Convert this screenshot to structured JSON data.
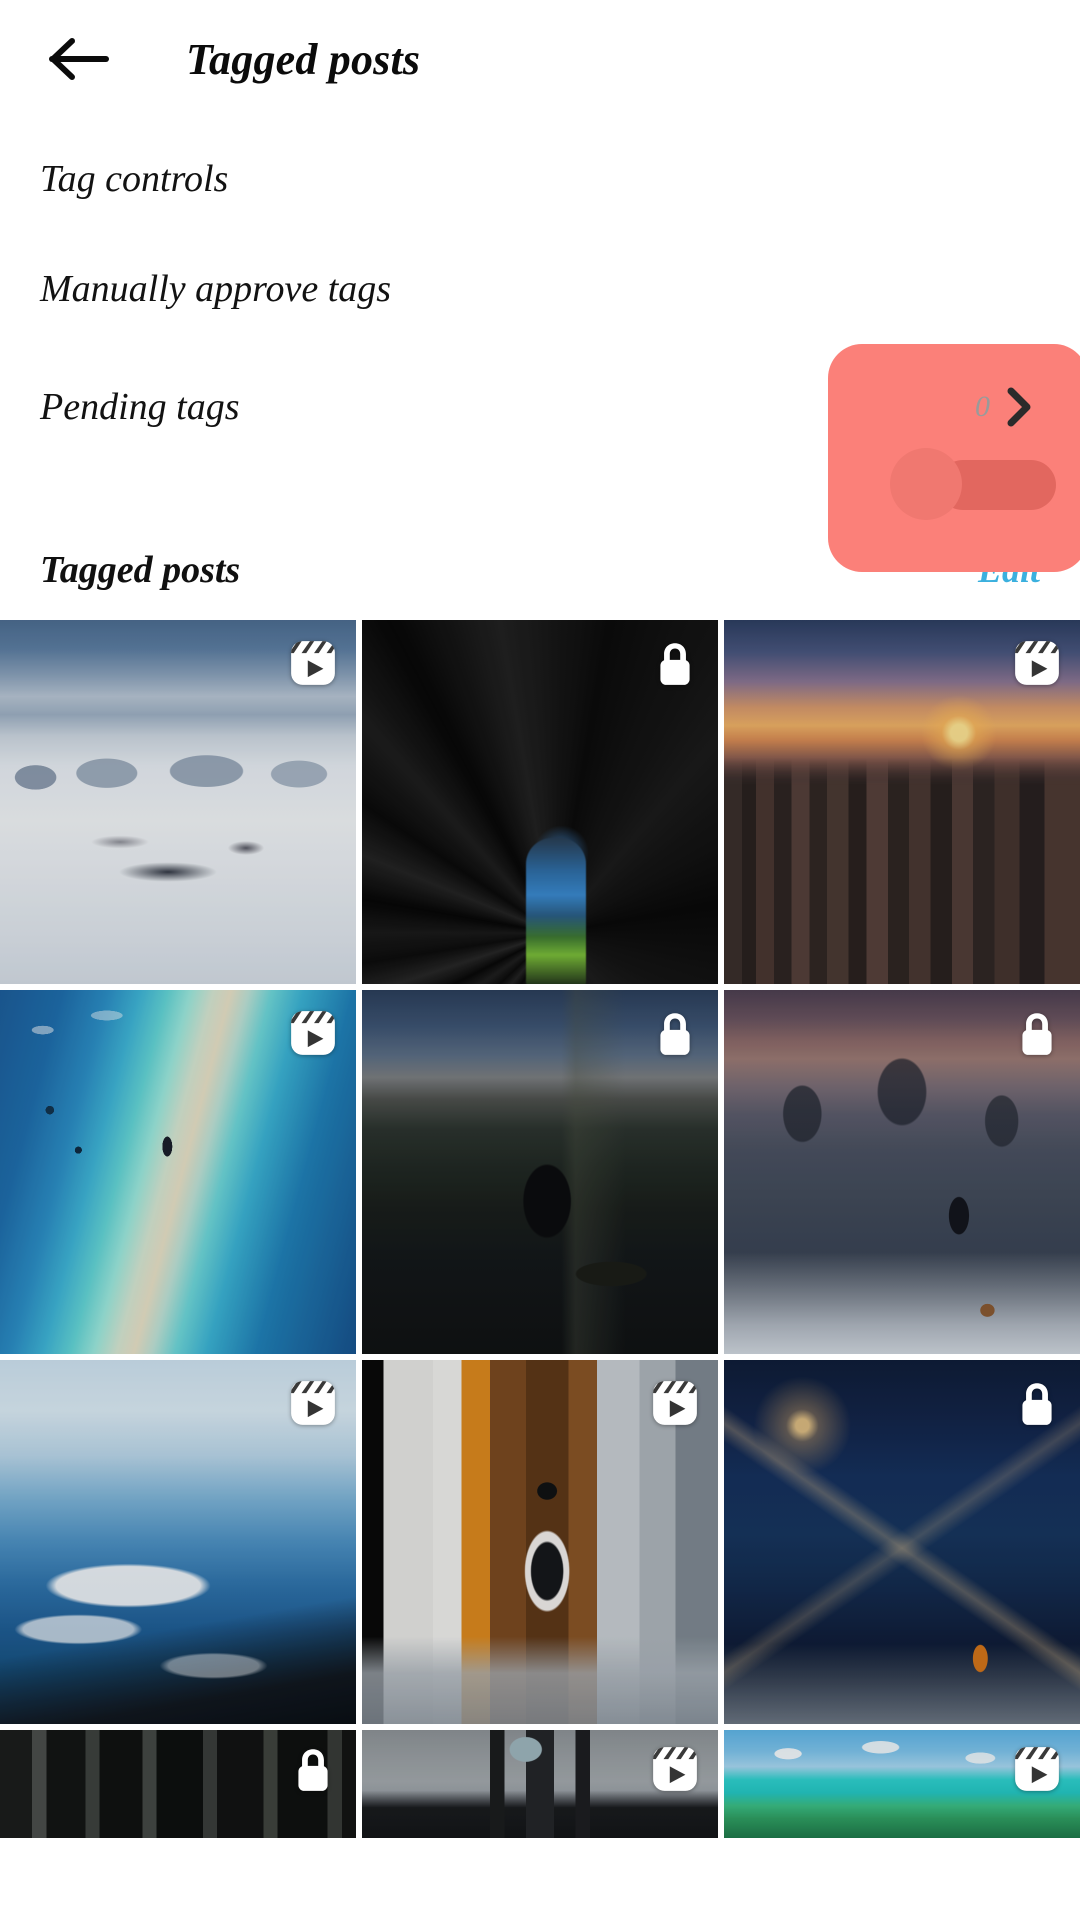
{
  "header": {
    "back_icon": "arrow-left-icon",
    "title": "Tagged posts"
  },
  "tag_controls": {
    "section_label": "Tag controls",
    "manual_approve": {
      "label": "Manually approve tags",
      "toggle_state": "off",
      "highlight_color": "#fb8079"
    },
    "pending_tags": {
      "label": "Pending tags",
      "count": "0",
      "chevron_icon": "chevron-right-icon"
    }
  },
  "tagged_posts": {
    "section_label": "Tagged posts",
    "edit_label": "Edit",
    "edit_color": "#3bb0de",
    "grid": [
      {
        "art": "ph-snowfield",
        "badge": "reels-icon",
        "alt": "snow-field-mountains"
      },
      {
        "art": "ph-forestup",
        "badge": "lock-icon",
        "alt": "looking-up-trees"
      },
      {
        "art": "ph-citysunset",
        "badge": "reels-icon",
        "alt": "city-skyline-sunset"
      },
      {
        "art": "ph-lagoon",
        "badge": "reels-icon",
        "alt": "aerial-lagoon-swimmer"
      },
      {
        "art": "ph-dusksit",
        "badge": "lock-icon",
        "alt": "person-sitting-dusk"
      },
      {
        "art": "ph-snowtrees",
        "badge": "lock-icon",
        "alt": "person-dog-snow-trees"
      },
      {
        "art": "ph-wave",
        "badge": "reels-icon",
        "alt": "boat-wake-wave"
      },
      {
        "art": "ph-dogboat",
        "badge": "reels-icon",
        "alt": "dog-on-boat-ramp"
      },
      {
        "art": "ph-starburst",
        "badge": "lock-icon",
        "alt": "person-arms-raised-night"
      },
      {
        "art": "ph-darkwoods",
        "badge": "lock-icon",
        "alt": "dark-woods"
      },
      {
        "art": "ph-ship",
        "badge": "reels-icon",
        "alt": "ship-deck"
      },
      {
        "art": "ph-tropical",
        "badge": "reels-icon",
        "alt": "tropical-island-water"
      }
    ]
  }
}
